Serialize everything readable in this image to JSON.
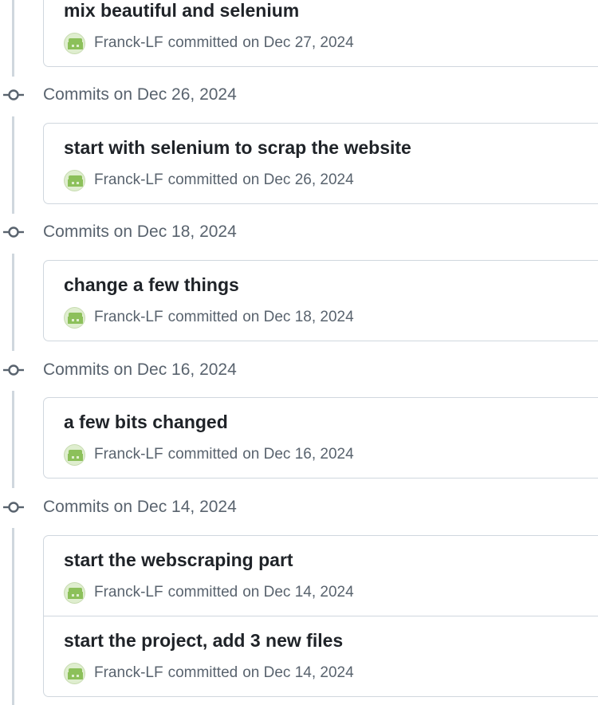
{
  "groups": [
    {
      "label": "",
      "commits": [
        {
          "title": "mix beautiful and selenium",
          "author": "Franck-LF",
          "verb": "committed",
          "date": "on Dec 27, 2024"
        }
      ]
    },
    {
      "label": "Commits on Dec 26, 2024",
      "commits": [
        {
          "title": "start with selenium to scrap the website",
          "author": "Franck-LF",
          "verb": "committed",
          "date": "on Dec 26, 2024"
        }
      ]
    },
    {
      "label": "Commits on Dec 18, 2024",
      "commits": [
        {
          "title": "change a few things",
          "author": "Franck-LF",
          "verb": "committed",
          "date": "on Dec 18, 2024"
        }
      ]
    },
    {
      "label": "Commits on Dec 16, 2024",
      "commits": [
        {
          "title": "a few bits changed",
          "author": "Franck-LF",
          "verb": "committed",
          "date": "on Dec 16, 2024"
        }
      ]
    },
    {
      "label": "Commits on Dec 14, 2024",
      "commits": [
        {
          "title": "start the webscraping part",
          "author": "Franck-LF",
          "verb": "committed",
          "date": "on Dec 14, 2024"
        },
        {
          "title": "start the project, add 3 new files",
          "author": "Franck-LF",
          "verb": "committed",
          "date": "on Dec 14, 2024"
        }
      ]
    }
  ],
  "icons": {
    "group_marker": "git-commit-icon",
    "avatar": "identicon-avatar"
  },
  "colors": {
    "text_primary": "#1f2328",
    "text_muted": "#59636e",
    "border": "#d0d7de",
    "avatar_green": "#8cc05a"
  }
}
